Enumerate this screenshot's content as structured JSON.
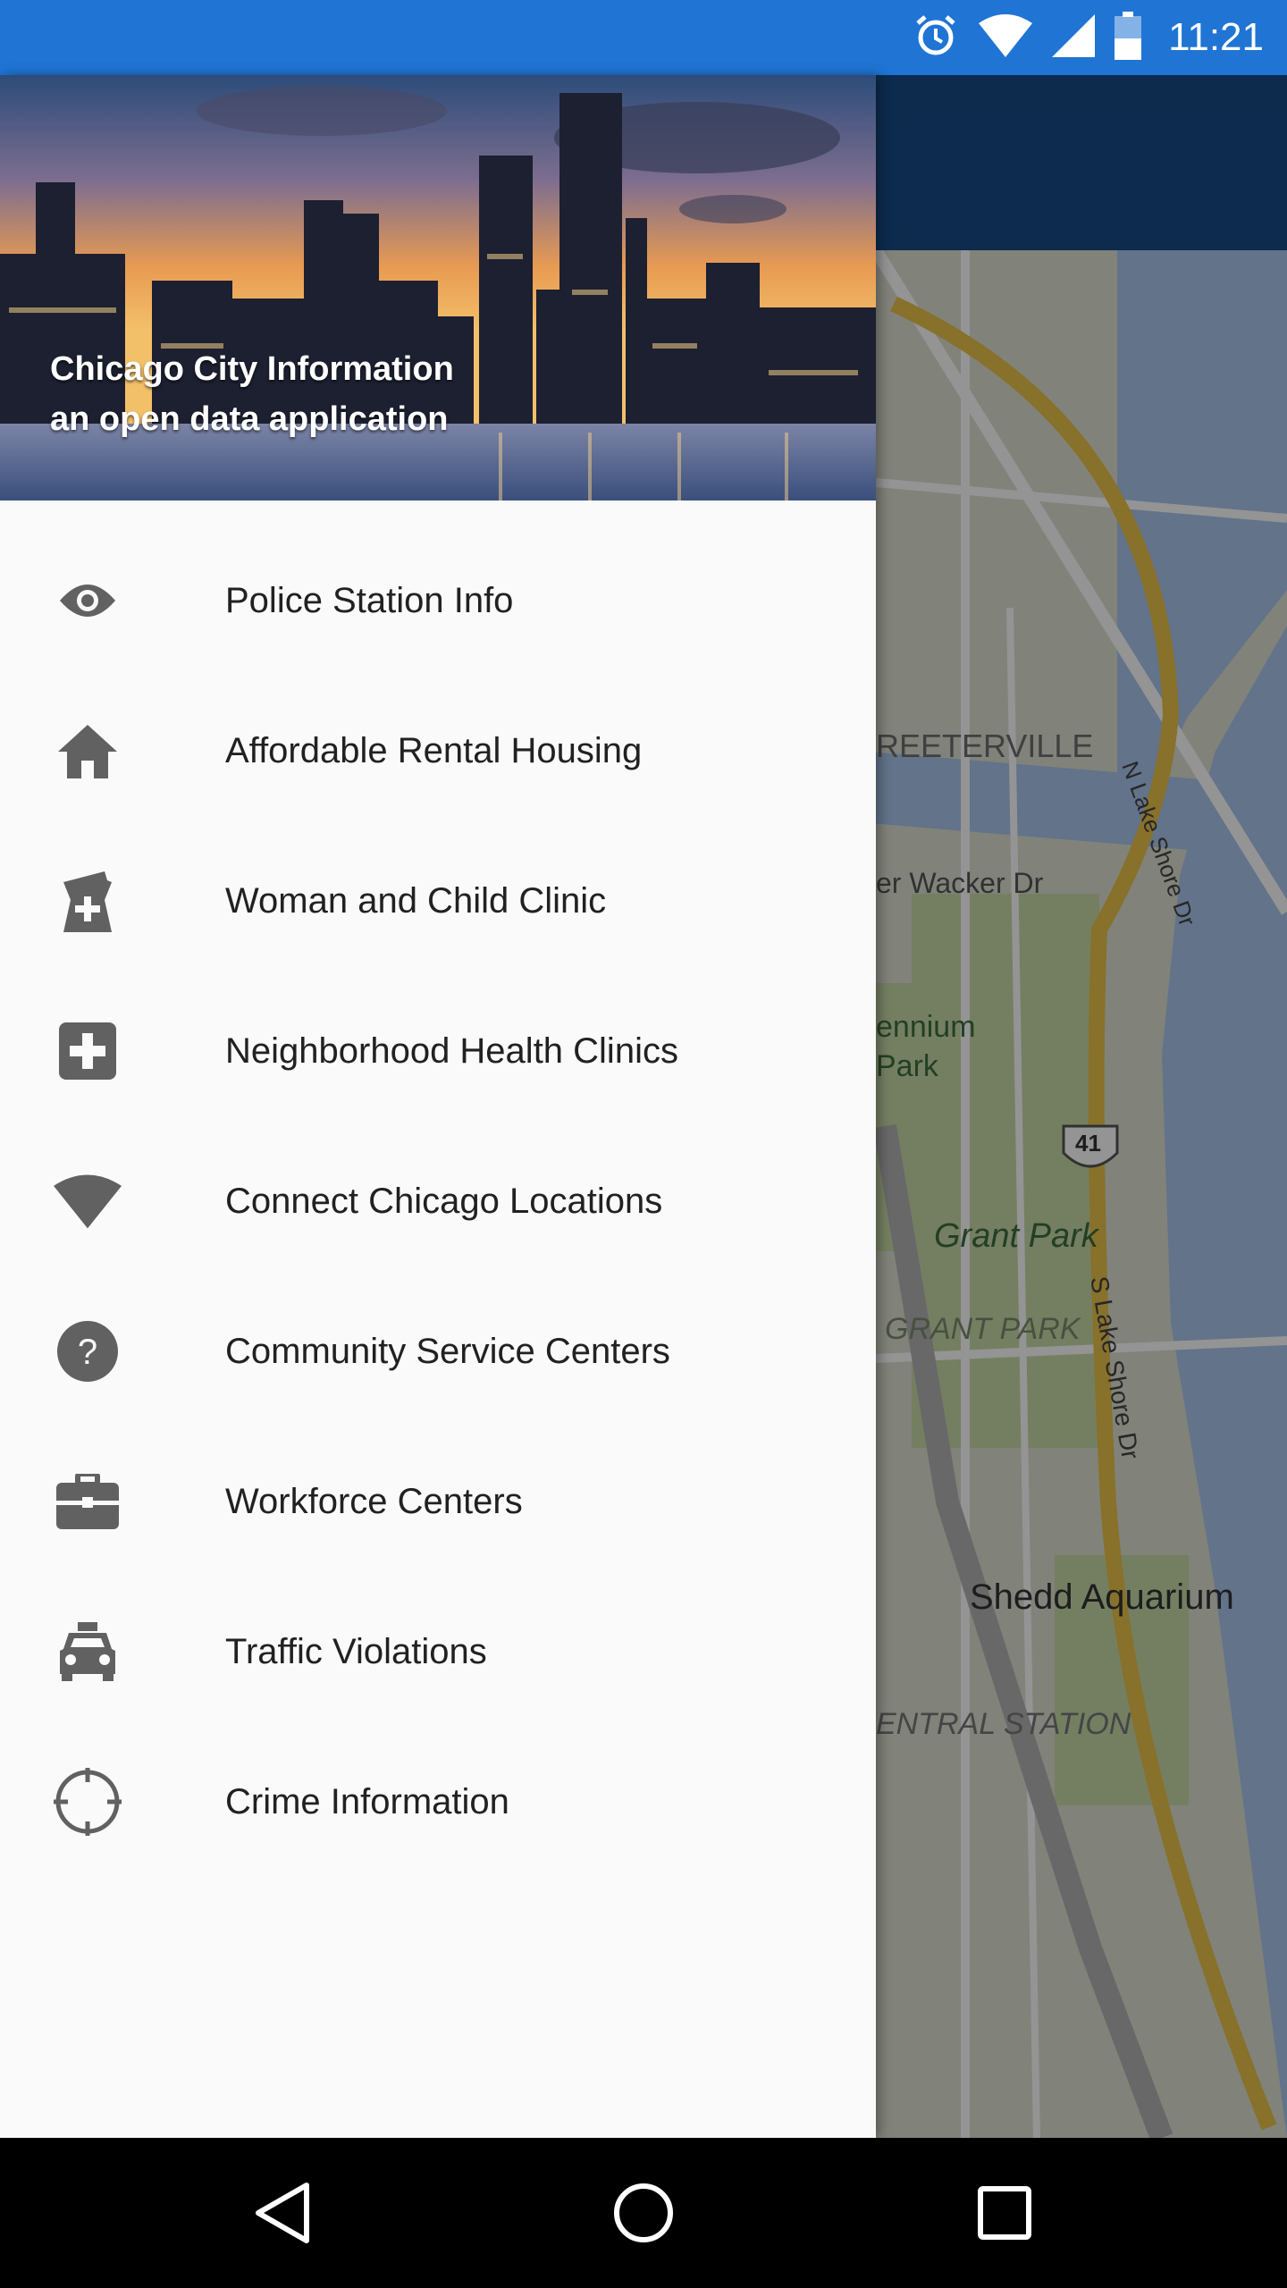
{
  "status_bar": {
    "time": "11:21",
    "icons": [
      "alarm-icon",
      "wifi-icon",
      "cell-signal-icon",
      "battery-icon"
    ]
  },
  "drawer": {
    "header": {
      "title": "Chicago City Information",
      "subtitle": "an open data application"
    },
    "items": [
      {
        "label": "Police Station Info",
        "icon": "eye-icon"
      },
      {
        "label": "Affordable Rental Housing",
        "icon": "home-icon"
      },
      {
        "label": "Woman and Child Clinic",
        "icon": "pharmacy-icon"
      },
      {
        "label": "Neighborhood Health Clinics",
        "icon": "hospital-icon"
      },
      {
        "label": "Connect Chicago Locations",
        "icon": "wifi-icon"
      },
      {
        "label": "Community Service Centers",
        "icon": "help-icon"
      },
      {
        "label": "Workforce Centers",
        "icon": "briefcase-icon"
      },
      {
        "label": "Traffic Violations",
        "icon": "taxi-icon"
      },
      {
        "label": "Crime Information",
        "icon": "crosshair-icon"
      }
    ]
  },
  "map": {
    "labels": [
      "REETERVILLE",
      "N Lake Shore Dr",
      "er Wacker Dr",
      "ennium Park",
      "41",
      "Grant Park",
      "GRANT PARK",
      "S Lake Shore Dr",
      "Shedd Aquarium",
      "ENTRAL STATION"
    ]
  },
  "navigation_bar": {
    "buttons": [
      "back-icon",
      "home-circle-icon",
      "recents-icon"
    ]
  },
  "colors": {
    "status_bar": "#1f74d4",
    "app_bar": "#164a86",
    "drawer_bg": "#fafafa",
    "icon_gray": "#616161",
    "text": "#212121"
  }
}
